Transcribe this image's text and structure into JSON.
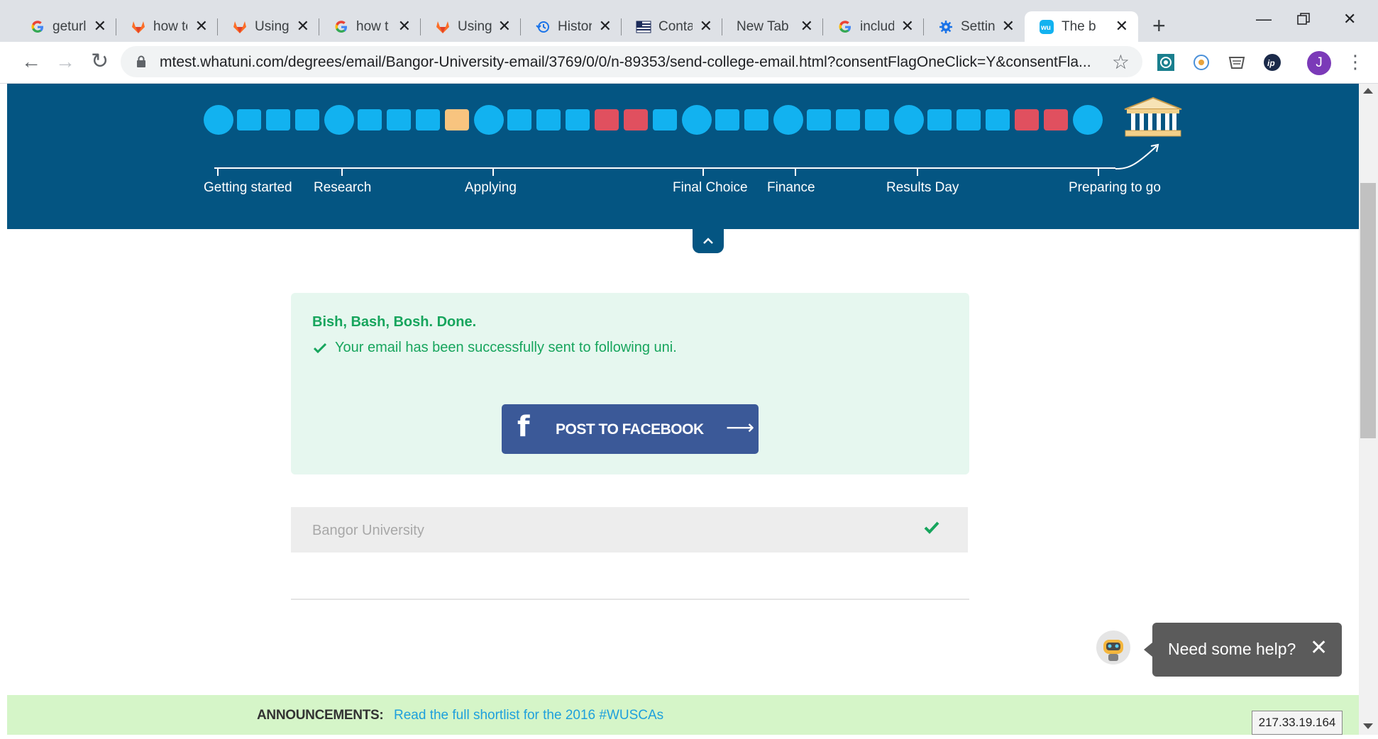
{
  "browser": {
    "tabs": [
      {
        "title": "geturl",
        "icon": "google-icon"
      },
      {
        "title": "how to",
        "icon": "gitlab-icon"
      },
      {
        "title": "Using",
        "icon": "gitlab-icon"
      },
      {
        "title": "how t",
        "icon": "google-icon"
      },
      {
        "title": "Using",
        "icon": "gitlab-icon"
      },
      {
        "title": "Histor",
        "icon": "history-icon"
      },
      {
        "title": "Conta",
        "icon": "flag-icon"
      },
      {
        "title": "New Tab",
        "icon": ""
      },
      {
        "title": "includ",
        "icon": "google-icon"
      },
      {
        "title": "Settin",
        "icon": "settings-icon"
      },
      {
        "title": "The b",
        "icon": "whatuni-icon"
      }
    ],
    "active_tab": 10,
    "url": "mtest.whatuni.com/degrees/email/Bangor-University-email/3769/0/0/n-89353/send-college-email.html?consentFlagOneClick=Y&consentFla...",
    "profile_initial": "J"
  },
  "timeline": {
    "stages": [
      "Getting started",
      "Research",
      "Applying",
      "Final Choice",
      "Finance",
      "Results Day",
      "Preparing to go"
    ],
    "colors": {
      "blue": "#12b2f0",
      "orange": "#f8c47f",
      "red": "#e0505f",
      "band": "#045582"
    }
  },
  "success": {
    "heading": "Bish, Bash, Bosh. Done.",
    "message": "Your email has been successfully sent to following uni.",
    "facebook_label": "POST TO FACEBOOK",
    "facebook_icon": "f"
  },
  "university": {
    "name": "Bangor University"
  },
  "help": {
    "text": "Need some help?"
  },
  "announcements": {
    "label": "ANNOUNCEMENTS:",
    "link": "Read the full shortlist for the 2016 #WUSCAs"
  },
  "ip_address": "217.33.19.164"
}
